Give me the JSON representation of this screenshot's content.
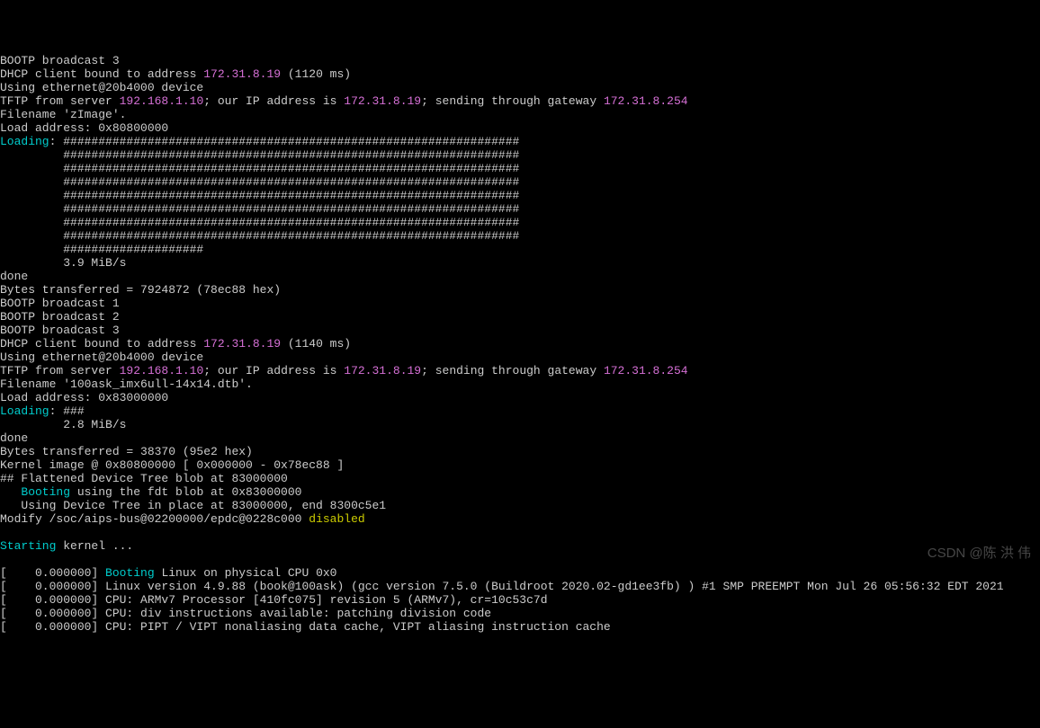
{
  "lines": {
    "l1": "BOOTP broadcast 3",
    "l2a": "DHCP client bound to address ",
    "l2b": "172.31.8.19",
    "l2c": " (1120 ms)",
    "l3": "Using ethernet@20b4000 device",
    "l4a": "TFTP from server ",
    "l4b": "192.168.1.10",
    "l4c": "; our IP address is ",
    "l4d": "172.31.8.19",
    "l4e": "; sending through gateway ",
    "l4f": "172.31.8.254",
    "l5": "Filename 'zImage'.",
    "l6": "Load address: 0x80800000",
    "l7a": "Loading",
    "l7b": ": #################################################################",
    "l8": "         #################################################################",
    "l9": "         #################################################################",
    "l10": "         #################################################################",
    "l11": "         #################################################################",
    "l12": "         #################################################################",
    "l13": "         #################################################################",
    "l14": "         #################################################################",
    "l15": "         ####################",
    "l16": "         3.9 MiB/s",
    "l17": "done",
    "l18": "Bytes transferred = 7924872 (78ec88 hex)",
    "l19": "BOOTP broadcast 1",
    "l20": "BOOTP broadcast 2",
    "l21": "BOOTP broadcast 3",
    "l22a": "DHCP client bound to address ",
    "l22b": "172.31.8.19",
    "l22c": " (1140 ms)",
    "l23": "Using ethernet@20b4000 device",
    "l24a": "TFTP from server ",
    "l24b": "192.168.1.10",
    "l24c": "; our IP address is ",
    "l24d": "172.31.8.19",
    "l24e": "; sending through gateway ",
    "l24f": "172.31.8.254",
    "l25": "Filename '100ask_imx6ull-14x14.dtb'.",
    "l26": "Load address: 0x83000000",
    "l27a": "Loading",
    "l27b": ": ###",
    "l28": "         2.8 MiB/s",
    "l29": "done",
    "l30": "Bytes transferred = 38370 (95e2 hex)",
    "l31": "Kernel image @ 0x80800000 [ 0x000000 - 0x78ec88 ]",
    "l32": "## Flattened Device Tree blob at 83000000",
    "l33a": "   ",
    "l33b": "Booting",
    "l33c": " using the fdt blob at 0x83000000",
    "l34": "   Using Device Tree in place at 83000000, end 8300c5e1",
    "l35a": "Modify /soc/aips-bus@02200000/epdc@0228c000 ",
    "l35b": "disabled",
    "l36a": "Starting",
    "l36b": " kernel ...",
    "l37a": "[    0.000000] ",
    "l37b": "Booting",
    "l37c": " Linux on physical CPU 0x0",
    "l38": "[    0.000000] Linux version 4.9.88 (book@100ask) (gcc version 7.5.0 (Buildroot 2020.02-gd1ee3fb) ) #1 SMP PREEMPT Mon Jul 26 05:56:32 EDT 2021",
    "l39": "[    0.000000] CPU: ARMv7 Processor [410fc075] revision 5 (ARMv7), cr=10c53c7d",
    "l40": "[    0.000000] CPU: div instructions available: patching division code",
    "l41": "[    0.000000] CPU: PIPT / VIPT nonaliasing data cache, VIPT aliasing instruction cache"
  },
  "watermark": "CSDN @陈 洪 伟"
}
